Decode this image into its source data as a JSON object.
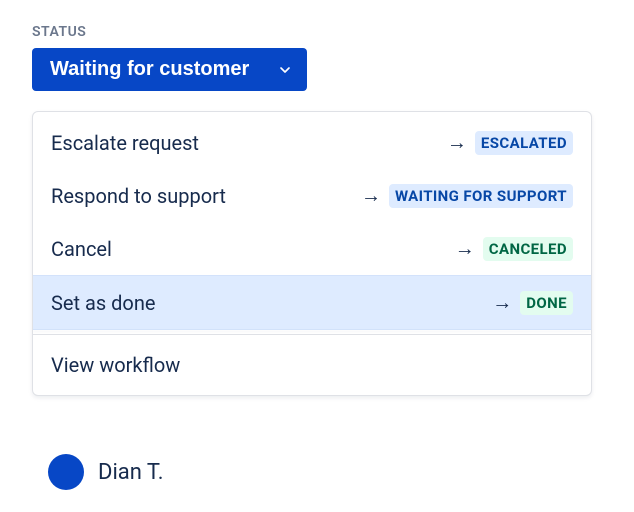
{
  "status": {
    "label": "STATUS",
    "current": "Waiting for customer"
  },
  "transitions": [
    {
      "label": "Escalate request",
      "target": "ESCALATED",
      "targetColor": "blue",
      "highlighted": false
    },
    {
      "label": "Respond to support",
      "target": "WAITING FOR SUPPORT",
      "targetColor": "blue",
      "highlighted": false
    },
    {
      "label": "Cancel",
      "target": "CANCELED",
      "targetColor": "green",
      "highlighted": false
    },
    {
      "label": "Set as done",
      "target": "DONE",
      "targetColor": "green",
      "highlighted": true
    }
  ],
  "footer": {
    "view_workflow": "View workflow"
  },
  "obscured": {
    "text": "Dian T."
  }
}
